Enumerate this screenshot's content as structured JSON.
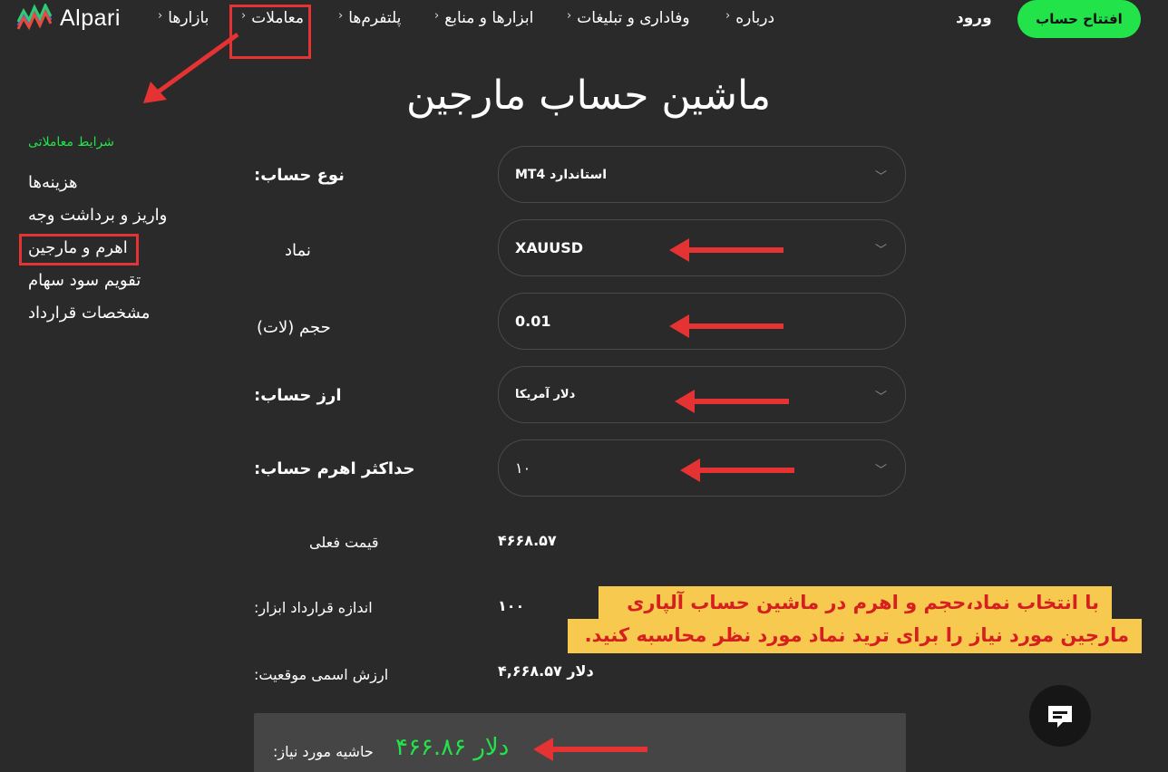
{
  "header": {
    "logo_text": "Alpari",
    "nav": [
      {
        "label": "بازارها"
      },
      {
        "label": "معاملات"
      },
      {
        "label": "پلتفرم‌ها"
      },
      {
        "label": "ابزارها و منابع"
      },
      {
        "label": "وفاداری و تبلیغات"
      },
      {
        "label": "درباره"
      }
    ],
    "login_label": "ورود",
    "open_account_label": "افتتاح حساب"
  },
  "page": {
    "title": "ماشین حساب مارجین"
  },
  "sidebar": {
    "heading": "شرایط معاملاتی",
    "items": [
      {
        "label": "هزینه‌ها"
      },
      {
        "label": "واریز و برداشت وجه"
      },
      {
        "label": "اهرم و مارجین"
      },
      {
        "label": "تقویم سود سهام"
      },
      {
        "label": "مشخصات قرارداد"
      }
    ]
  },
  "form": {
    "account_type": {
      "label": "نوع حساب:",
      "value": "MT4 استاندارد"
    },
    "symbol": {
      "label": "نماد",
      "value": "XAUUSD"
    },
    "volume": {
      "label": "حجم (لات)",
      "value": "0.01"
    },
    "currency": {
      "label": "ارز حساب:",
      "value": "دلار آمریکا"
    },
    "max_leverage": {
      "label": "حداکثر اهرم حساب:",
      "value": "۱۰"
    }
  },
  "results": {
    "current_price": {
      "label": "قیمت فعلی",
      "value": "۴۶۶۸.۵۷"
    },
    "contract_size": {
      "label": "اندازه قرارداد ابزار:",
      "value": "۱۰۰"
    },
    "notional": {
      "label": "ارزش اسمی موقعیت:",
      "value": "دلار ۴,۶۶۸.۵۷"
    },
    "required_margin": {
      "label": "حاشیه مورد نیاز:",
      "value": "دلار ۴۶۶.۸۶"
    }
  },
  "annotation": {
    "line1": "با انتخاب نماد،حجم و اهرم در ماشین حساب آلپاری",
    "line2": "مارجین مورد نیاز را برای ترید نماد مورد نظر محاسبه کنید."
  },
  "colors": {
    "background": "#2a2a2a",
    "accent_green": "#22e34a",
    "annotation_red": "#e53232",
    "note_yellow": "#f7c94f"
  },
  "icons": [
    "alpari-logo-icon",
    "chevron-icon",
    "chevron-down-icon",
    "chat-icon",
    "arrow-icon"
  ]
}
